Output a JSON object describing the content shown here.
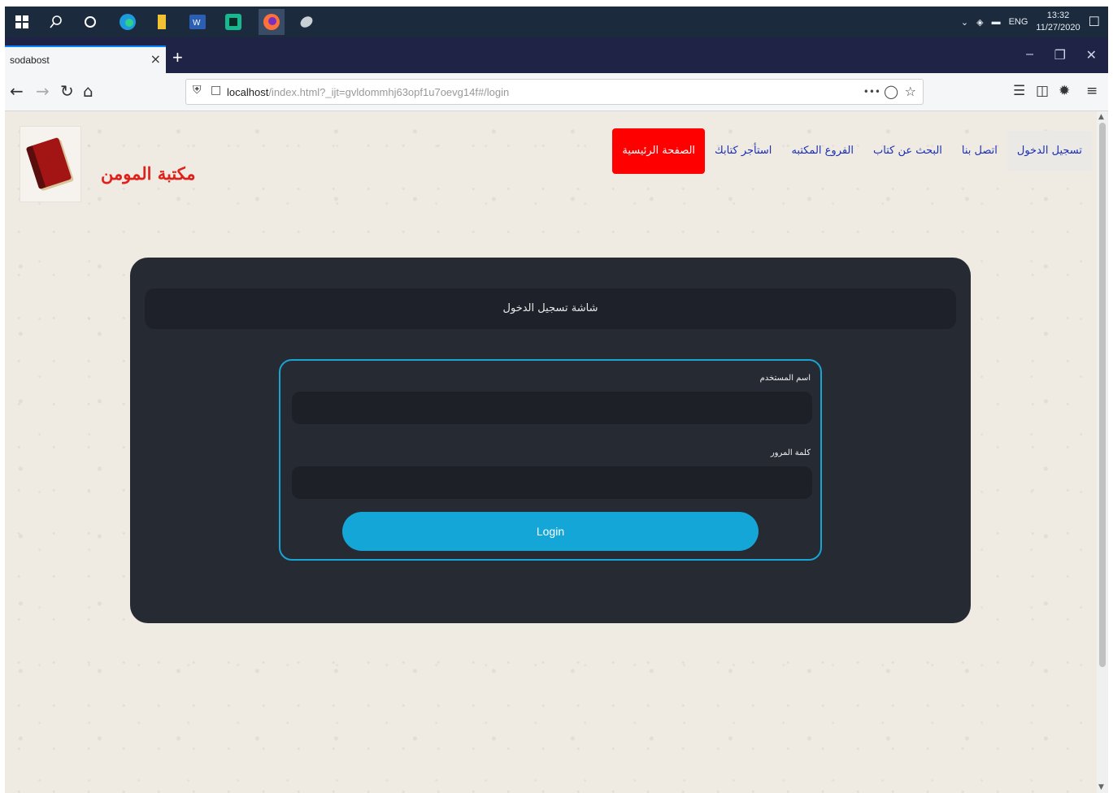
{
  "taskbar": {
    "language": "ENG",
    "time": "13:32",
    "date": "11/27/2020"
  },
  "browser": {
    "tab_title": "sodabost",
    "tab_close": "×",
    "new_tab": "+",
    "url_host": "localhost",
    "url_path": "/index.html?_ijt=gvldommhj63opf1u7oevg14f#/login",
    "url_more": "•••"
  },
  "site": {
    "name": "مكتبة المومن",
    "menu": {
      "login": "تسجيل الدخول",
      "contact": "اتصل بنا",
      "search": "البحث عن كتاب",
      "branches": "الفروع المكتبه",
      "rent": "استأجر كتابك",
      "home": "الصفحة الرئيسية"
    }
  },
  "login_card": {
    "title": "شاشة تسجيل الدخول",
    "username_label": "اسم المستخدم",
    "password_label": "كلمة المرور",
    "username_value": "",
    "password_value": "",
    "submit_label": "Login"
  },
  "colors": {
    "brand_red": "#e0201a",
    "accent_blue": "#15a6d8",
    "card_bg": "#262a33"
  }
}
